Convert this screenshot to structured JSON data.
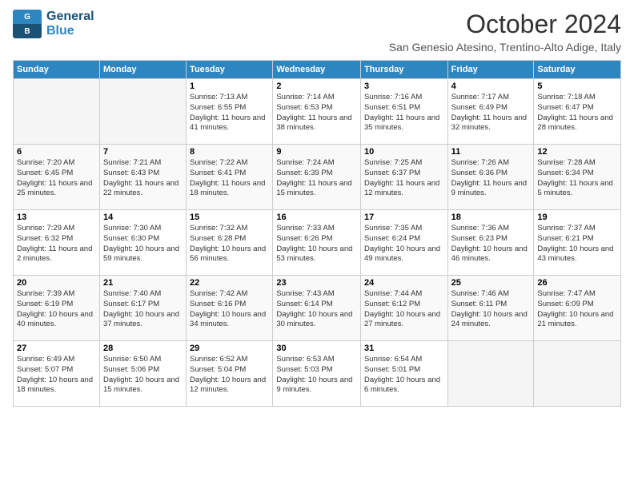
{
  "logo": {
    "line1": "General",
    "line2": "Blue"
  },
  "title": "October 2024",
  "subtitle": "San Genesio Atesino, Trentino-Alto Adige, Italy",
  "headers": [
    "Sunday",
    "Monday",
    "Tuesday",
    "Wednesday",
    "Thursday",
    "Friday",
    "Saturday"
  ],
  "weeks": [
    [
      {
        "day": "",
        "info": ""
      },
      {
        "day": "",
        "info": ""
      },
      {
        "day": "1",
        "info": "Sunrise: 7:13 AM\nSunset: 6:55 PM\nDaylight: 11 hours and 41 minutes."
      },
      {
        "day": "2",
        "info": "Sunrise: 7:14 AM\nSunset: 6:53 PM\nDaylight: 11 hours and 38 minutes."
      },
      {
        "day": "3",
        "info": "Sunrise: 7:16 AM\nSunset: 6:51 PM\nDaylight: 11 hours and 35 minutes."
      },
      {
        "day": "4",
        "info": "Sunrise: 7:17 AM\nSunset: 6:49 PM\nDaylight: 11 hours and 32 minutes."
      },
      {
        "day": "5",
        "info": "Sunrise: 7:18 AM\nSunset: 6:47 PM\nDaylight: 11 hours and 28 minutes."
      }
    ],
    [
      {
        "day": "6",
        "info": "Sunrise: 7:20 AM\nSunset: 6:45 PM\nDaylight: 11 hours and 25 minutes."
      },
      {
        "day": "7",
        "info": "Sunrise: 7:21 AM\nSunset: 6:43 PM\nDaylight: 11 hours and 22 minutes."
      },
      {
        "day": "8",
        "info": "Sunrise: 7:22 AM\nSunset: 6:41 PM\nDaylight: 11 hours and 18 minutes."
      },
      {
        "day": "9",
        "info": "Sunrise: 7:24 AM\nSunset: 6:39 PM\nDaylight: 11 hours and 15 minutes."
      },
      {
        "day": "10",
        "info": "Sunrise: 7:25 AM\nSunset: 6:37 PM\nDaylight: 11 hours and 12 minutes."
      },
      {
        "day": "11",
        "info": "Sunrise: 7:26 AM\nSunset: 6:36 PM\nDaylight: 11 hours and 9 minutes."
      },
      {
        "day": "12",
        "info": "Sunrise: 7:28 AM\nSunset: 6:34 PM\nDaylight: 11 hours and 5 minutes."
      }
    ],
    [
      {
        "day": "13",
        "info": "Sunrise: 7:29 AM\nSunset: 6:32 PM\nDaylight: 11 hours and 2 minutes."
      },
      {
        "day": "14",
        "info": "Sunrise: 7:30 AM\nSunset: 6:30 PM\nDaylight: 10 hours and 59 minutes."
      },
      {
        "day": "15",
        "info": "Sunrise: 7:32 AM\nSunset: 6:28 PM\nDaylight: 10 hours and 56 minutes."
      },
      {
        "day": "16",
        "info": "Sunrise: 7:33 AM\nSunset: 6:26 PM\nDaylight: 10 hours and 53 minutes."
      },
      {
        "day": "17",
        "info": "Sunrise: 7:35 AM\nSunset: 6:24 PM\nDaylight: 10 hours and 49 minutes."
      },
      {
        "day": "18",
        "info": "Sunrise: 7:36 AM\nSunset: 6:23 PM\nDaylight: 10 hours and 46 minutes."
      },
      {
        "day": "19",
        "info": "Sunrise: 7:37 AM\nSunset: 6:21 PM\nDaylight: 10 hours and 43 minutes."
      }
    ],
    [
      {
        "day": "20",
        "info": "Sunrise: 7:39 AM\nSunset: 6:19 PM\nDaylight: 10 hours and 40 minutes."
      },
      {
        "day": "21",
        "info": "Sunrise: 7:40 AM\nSunset: 6:17 PM\nDaylight: 10 hours and 37 minutes."
      },
      {
        "day": "22",
        "info": "Sunrise: 7:42 AM\nSunset: 6:16 PM\nDaylight: 10 hours and 34 minutes."
      },
      {
        "day": "23",
        "info": "Sunrise: 7:43 AM\nSunset: 6:14 PM\nDaylight: 10 hours and 30 minutes."
      },
      {
        "day": "24",
        "info": "Sunrise: 7:44 AM\nSunset: 6:12 PM\nDaylight: 10 hours and 27 minutes."
      },
      {
        "day": "25",
        "info": "Sunrise: 7:46 AM\nSunset: 6:11 PM\nDaylight: 10 hours and 24 minutes."
      },
      {
        "day": "26",
        "info": "Sunrise: 7:47 AM\nSunset: 6:09 PM\nDaylight: 10 hours and 21 minutes."
      }
    ],
    [
      {
        "day": "27",
        "info": "Sunrise: 6:49 AM\nSunset: 5:07 PM\nDaylight: 10 hours and 18 minutes."
      },
      {
        "day": "28",
        "info": "Sunrise: 6:50 AM\nSunset: 5:06 PM\nDaylight: 10 hours and 15 minutes."
      },
      {
        "day": "29",
        "info": "Sunrise: 6:52 AM\nSunset: 5:04 PM\nDaylight: 10 hours and 12 minutes."
      },
      {
        "day": "30",
        "info": "Sunrise: 6:53 AM\nSunset: 5:03 PM\nDaylight: 10 hours and 9 minutes."
      },
      {
        "day": "31",
        "info": "Sunrise: 6:54 AM\nSunset: 5:01 PM\nDaylight: 10 hours and 6 minutes."
      },
      {
        "day": "",
        "info": ""
      },
      {
        "day": "",
        "info": ""
      }
    ]
  ]
}
